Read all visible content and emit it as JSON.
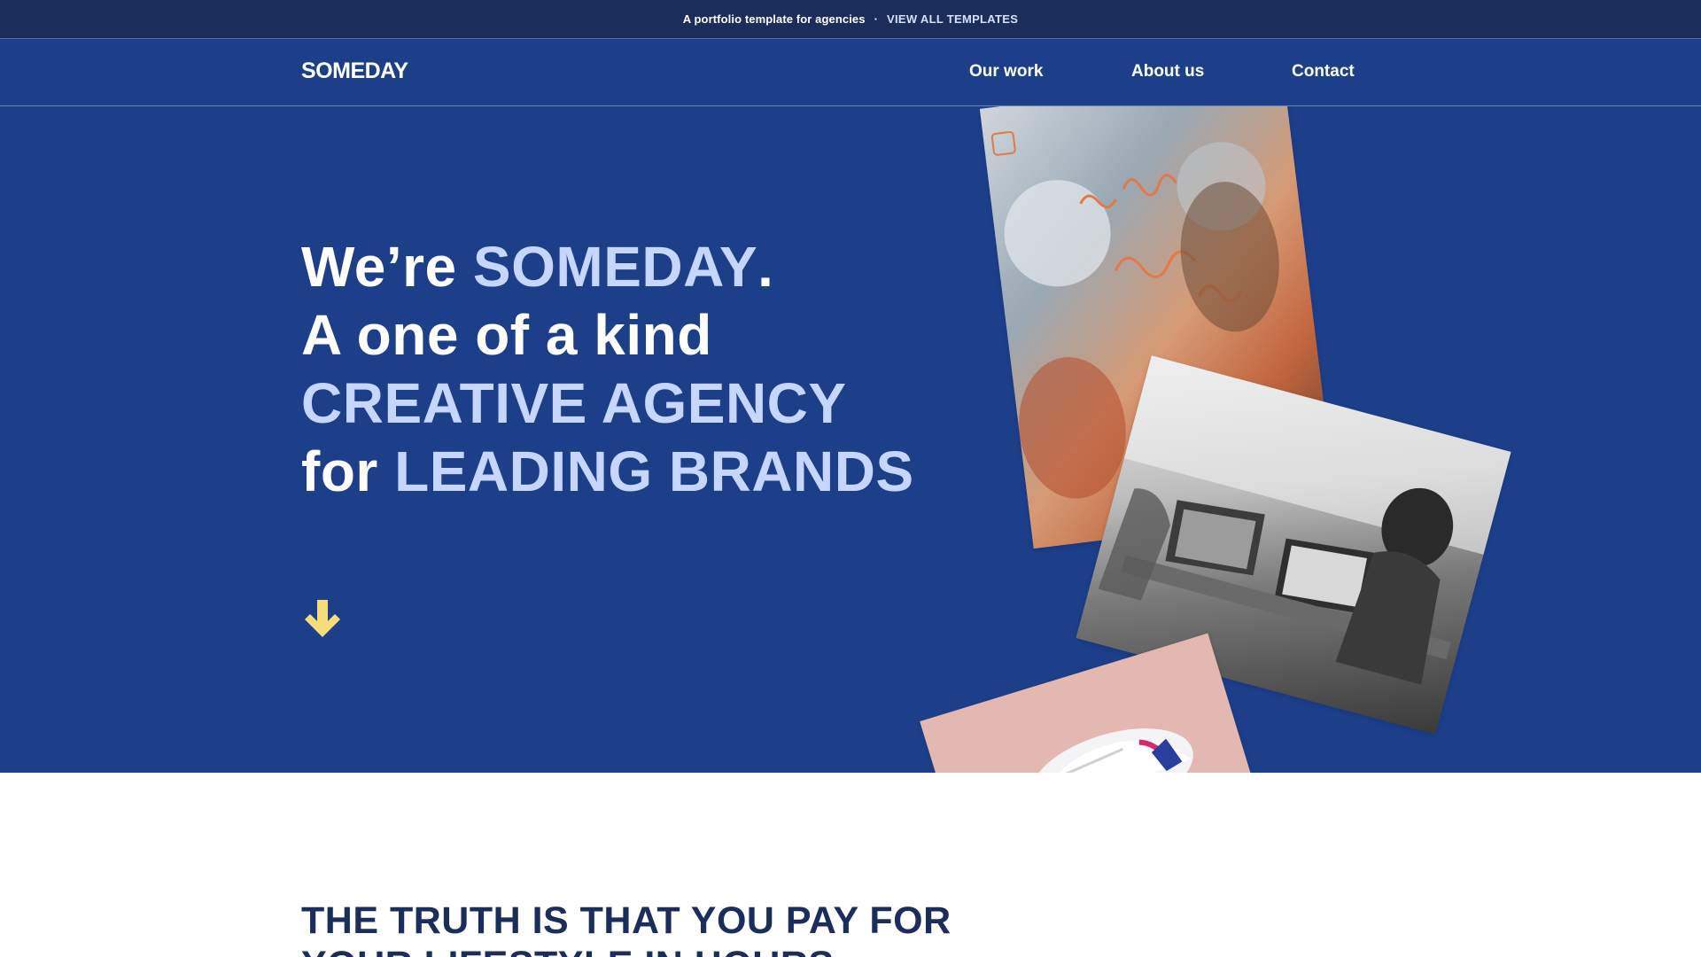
{
  "announcement": {
    "text": "A portfolio template for agencies",
    "separator": "·",
    "link_label": "VIEW ALL TEMPLATES"
  },
  "nav": {
    "logo": "SOMEDAY",
    "links": [
      {
        "label": "Our work"
      },
      {
        "label": "About us"
      },
      {
        "label": "Contact"
      }
    ]
  },
  "hero": {
    "line1_a": "We’re ",
    "line1_b": "SOMEDAY",
    "line1_c": ".",
    "line2": "A one of a kind",
    "line3": "CREATIVE AGENCY",
    "line4_a": "for ",
    "line4_b": "LEADING BRANDS",
    "arrow_icon": "arrow-down-icon",
    "photos": [
      "whiteboard-photo",
      "office-laptops-photo",
      "sneaker-photo"
    ]
  },
  "section_two": {
    "heading": "THE TRUTH IS THAT YOU PAY FOR YOUR LIFESTYLE IN HOURS"
  },
  "colors": {
    "topbar": "#1b2d5b",
    "hero_bg": "#1d3f8a",
    "highlight": "#c6d6ff",
    "arrow": "#f7dd7a",
    "heading_dark": "#1b2d5b"
  }
}
